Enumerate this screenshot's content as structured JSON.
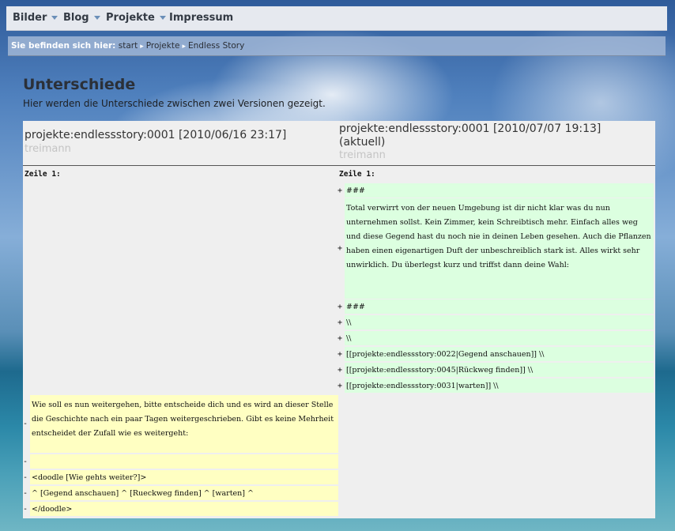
{
  "nav": {
    "items": [
      {
        "label": "Bilder",
        "dropdown": true
      },
      {
        "label": "Blog",
        "dropdown": true
      },
      {
        "label": "Projekte",
        "dropdown": true
      },
      {
        "label": "Impressum",
        "dropdown": false
      }
    ]
  },
  "breadcrumb": {
    "lead": "Sie befinden sich hier:",
    "items": [
      "start",
      "Projekte",
      "Endless Story"
    ]
  },
  "page": {
    "title": "Unterschiede",
    "intro": "Hier werden die Unterschiede zwischen zwei Versionen gezeigt."
  },
  "diff": {
    "left": {
      "revision": "projekte:endlessstory:0001 [2010/06/16 23:17]",
      "user": "treimann",
      "line_label": "Zeile 1:"
    },
    "right": {
      "revision": "projekte:endlessstory:0001 [2010/07/07 19:13]",
      "revision_note": "(aktuell)",
      "user": "treimann",
      "line_label": "Zeile 1:"
    },
    "added_lines": [
      {
        "sign": "+",
        "text": "###"
      },
      {
        "sign": "+",
        "text": "Total verwirrt von der neuen Umgebung ist dir nicht klar was du nun unternehmen sollst. Kein Zimmer, kein Schreibtisch mehr. Einfach alles weg und diese Gegend hast du noch nie in deinen Leben gesehen. Auch die Pflanzen haben einen eigenartigen Duft der unbeschreiblich stark ist. Alles wirkt sehr unwirklich. Du überlegst kurz und triffst dann deine Wahl:"
      },
      {
        "sign": "+",
        "text": "###"
      },
      {
        "sign": "+",
        "text": "\\\\"
      },
      {
        "sign": "+",
        "text": "\\\\"
      },
      {
        "sign": "+",
        "text": "[[projekte:endlessstory:0022|Gegend anschauen]] \\\\"
      },
      {
        "sign": "+",
        "text": "[[projekte:endlessstory:0045|Rückweg finden]] \\\\"
      },
      {
        "sign": "+",
        "text": "[[projekte:endlessstory:0031|warten]] \\\\"
      }
    ],
    "deleted_lines": [
      {
        "sign": "-",
        "text": "Wie soll es nun weitergehen, bitte entscheide dich und es wird an dieser Stelle die Geschichte nach ein paar Tagen weitergeschrieben. Gibt es keine Mehrheit entscheidet der Zufall wie es weitergeht:"
      },
      {
        "sign": "-",
        "text": ""
      },
      {
        "sign": "-",
        "text": "<doodle [Wie gehts weiter?]>"
      },
      {
        "sign": "-",
        "text": "^ [Gegend anschauen] ^ [Rueckweg finden] ^ [warten] ^"
      },
      {
        "sign": "-",
        "text": "</doodle>"
      }
    ]
  },
  "colors": {
    "added_bg": "#dcffe0",
    "deleted_bg": "#ffffc2",
    "nav_bg": "#e6e9ef",
    "breadcrumb_bg": "#a0b6d6"
  }
}
